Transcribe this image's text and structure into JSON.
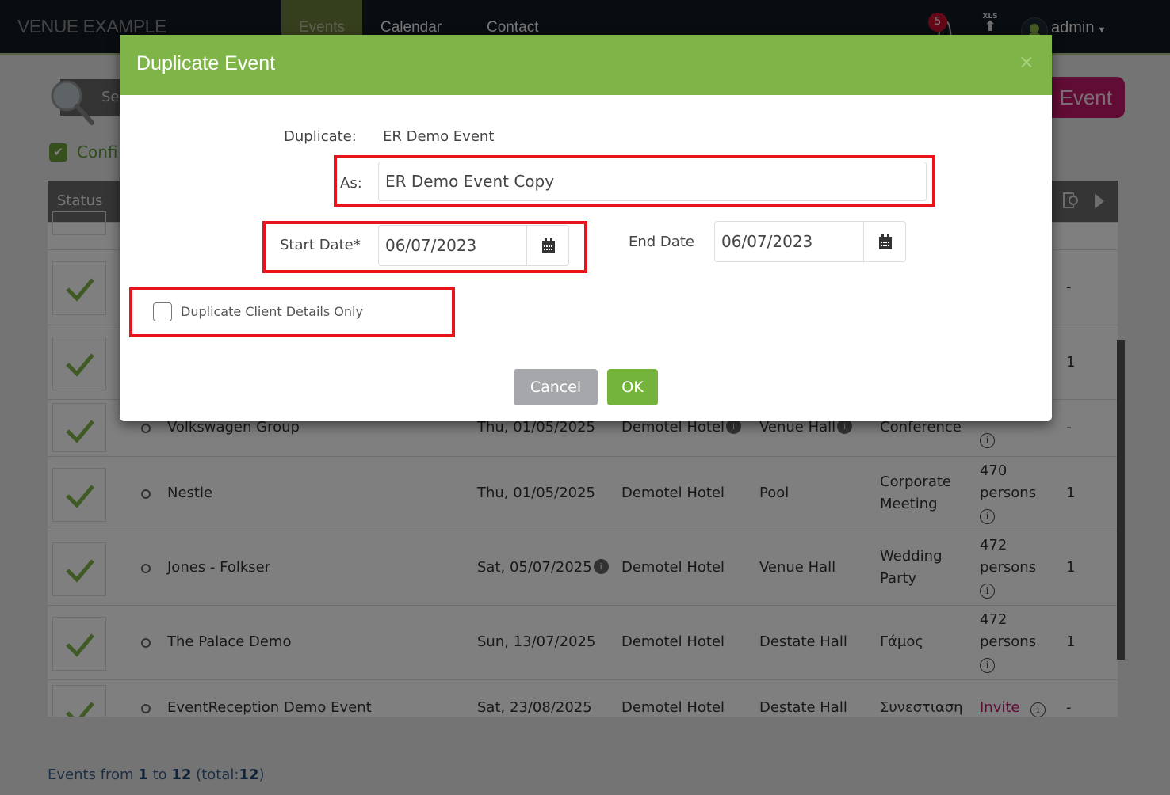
{
  "app": {
    "brand": "VENUE EXAMPLE",
    "nav": [
      {
        "label": "Events",
        "active": true
      },
      {
        "label": "Calendar",
        "active": false
      },
      {
        "label": "Contact",
        "active": false
      }
    ],
    "notifications": {
      "icon": "bell-icon",
      "count": "5"
    },
    "export": {
      "icon": "xls-export-icon",
      "label": "XLS"
    },
    "user": {
      "icon": "user-avatar-icon",
      "name": "admin"
    }
  },
  "page": {
    "search_placeholder": "Se",
    "new_event_button": "Event",
    "confirmed_filter": {
      "label": "Confi",
      "checked": true
    },
    "table": {
      "header_status": "Status",
      "rows": [
        {
          "client": "Volkswagen Group",
          "date": "Thu, 01/05/2025",
          "hotel": "Demotel Hotel",
          "hall": "Venue Hall",
          "type": "Conference",
          "attendance": "",
          "count": "-"
        },
        {
          "client": "Nestle",
          "date": "Thu, 01/05/2025",
          "hotel": "Demotel Hotel",
          "hall": "Pool",
          "type": "Corporate Meeting",
          "attendance": "470 persons",
          "count": "1"
        },
        {
          "client": "Jones - Folkser",
          "date": "Sat, 05/07/2025",
          "hotel": "Demotel Hotel",
          "hall": "Venue Hall",
          "type": "Wedding Party",
          "attendance": "472 persons",
          "count": "1"
        },
        {
          "client": "The Palace Demo",
          "date": "Sun, 13/07/2025",
          "hotel": "Demotel Hotel",
          "hall": "Destate Hall",
          "type": "Γάμος",
          "attendance": "472 persons",
          "count": "1"
        },
        {
          "client": "EventReception Demo Event",
          "date": "Sat, 23/08/2025",
          "hotel": "Demotel Hotel",
          "hall": "Destate Hall",
          "type": "Συνεστιαση",
          "attendance": "Invite",
          "count": "-"
        }
      ],
      "hidden_rows_counts": [
        "-",
        "1"
      ]
    },
    "footer": {
      "prefix": "Events from",
      "from": "1",
      "to_word": "to",
      "to": "12",
      "total_prefix": "(total:",
      "total": "12",
      "total_suffix": ")"
    }
  },
  "modal": {
    "title": "Duplicate Event",
    "close_icon": "×",
    "duplicate_label": "Duplicate:",
    "duplicate_value": "ER Demo Event",
    "as_label": "As:",
    "as_value": "ER Demo Event Copy",
    "start_date_label": "Start Date*",
    "start_date_value": "06/07/2023",
    "end_date_label": "End Date",
    "end_date_value": "06/07/2023",
    "client_only_label": "Duplicate Client Details Only",
    "client_only_checked": false,
    "cancel_label": "Cancel",
    "ok_label": "OK",
    "highlight_color": "#e8141b",
    "header_color": "#7fb548"
  }
}
